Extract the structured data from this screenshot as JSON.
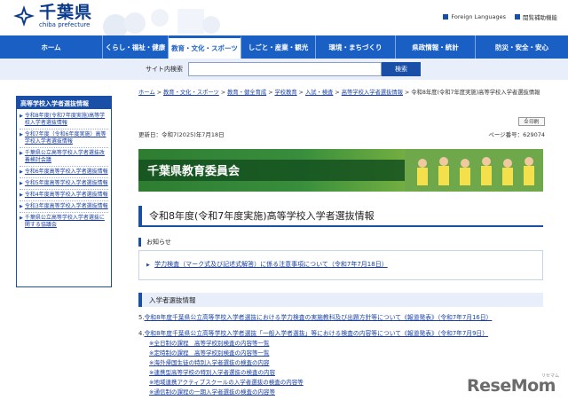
{
  "header": {
    "logo_jp": "千葉県",
    "logo_en": "chiba prefecture",
    "links": [
      {
        "label": "Foreign Languages"
      },
      {
        "label": "閲覧補助機能"
      }
    ]
  },
  "nav": {
    "items": [
      {
        "label": "ホーム"
      },
      {
        "label": "くらし・福祉・健康"
      },
      {
        "label": "教育・文化・スポーツ"
      },
      {
        "label": "しごと・産業・観光"
      },
      {
        "label": "環境・まちづくり"
      },
      {
        "label": "県政情報・統計"
      },
      {
        "label": "防災・安全・安心"
      }
    ],
    "active_index": 2
  },
  "search": {
    "label": "サイト内検索",
    "placeholder": "",
    "button": "検索"
  },
  "sidebar": {
    "title": "高等学校入学者選抜情報",
    "items": [
      {
        "label": "令和8年度(令和7年度実施)高等学校入学者選抜情報"
      },
      {
        "label": "令和7年度（令和6年度実施）高等学校入学者選抜情報"
      },
      {
        "label": "千葉県公立高等学校入学者選抜改善検討会議"
      },
      {
        "label": "令和6年度高等学校入学者選抜情報"
      },
      {
        "label": "令和5年度高等学校入学者選抜情報"
      },
      {
        "label": "令和4年度高等学校入学者選抜情報"
      },
      {
        "label": "令和3年度高等学校入学者選抜情報"
      },
      {
        "label": "千葉県公立高等学校入学者選抜に関する協議会"
      }
    ]
  },
  "breadcrumb": {
    "items": [
      {
        "label": "ホーム"
      },
      {
        "label": "教育・文化・スポーツ"
      },
      {
        "label": "教育・健全育成"
      },
      {
        "label": "学校教育"
      },
      {
        "label": "入試・検査"
      },
      {
        "label": "高等学校入学者選抜情報"
      }
    ],
    "current": "令和8年度(令和7年度実施)高等学校入学者選抜情報"
  },
  "print_label": "印刷",
  "meta": {
    "updated": "更新日：令和7(2025)年7月18日",
    "page_no": "ページ番号：629074"
  },
  "banner_text": "千葉県教育委員会",
  "page_title": "令和8年度(令和7年度実施)高等学校入学者選抜情報",
  "notice": {
    "heading": "お知らせ",
    "link": "学力検査（マーク式及び記述式解答）に係る注意事項について（令和7年7月18日）"
  },
  "section": {
    "heading": "入学者選抜情報"
  },
  "entries": [
    {
      "num": "5.",
      "link": "令和8年度千葉県公立高等学校入学者選抜における学力検査の実施教科及び出題方針等について《報道発表》（令和7年7月16日）"
    },
    {
      "num": "4.",
      "link": "令和8年度千葉県公立高等学校入学者選抜「一般入学者選抜」等における検査の内容等について《報道発表》（令和7年7月9日）"
    }
  ],
  "sub_items": [
    {
      "label": "※全日制の課程　高等学校別検査の内容等一覧"
    },
    {
      "label": "※定時制の課程　高等学校別検査の内容等一覧"
    },
    {
      "label": "※海外帰国生徒の特別入学者選抜の検査の内容"
    },
    {
      "label": "※連携型高等学校の特別入学者選抜の検査の内容"
    },
    {
      "label": "※地域連携アクティブスクールの入学者選抜の検査の内容等"
    },
    {
      "label": "※通信制の課程の一期入学者選抜の検査の内容等"
    }
  ],
  "watermark": {
    "text": "ReseMom",
    "sub": "リセマム"
  },
  "colors": {
    "primary": "#1a5fc4",
    "dark_blue": "#1a4fa8",
    "link": "#1a3fa0",
    "banner_green": "#2e7d32"
  }
}
